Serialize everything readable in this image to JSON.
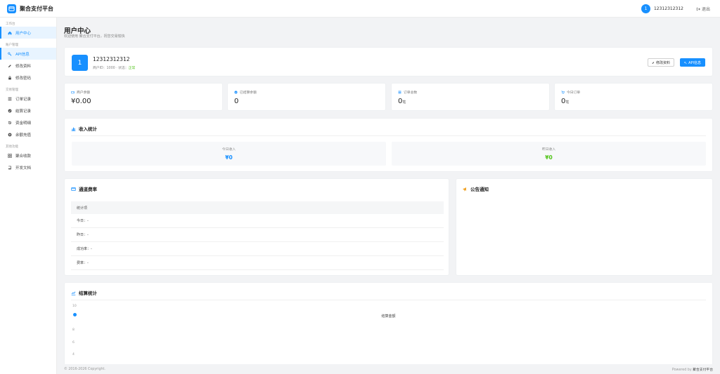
{
  "app": {
    "name": "聚合支付平台"
  },
  "header": {
    "user": "12312312312",
    "avatar_text": "1",
    "logout": "退出"
  },
  "sidebar": {
    "groups": [
      {
        "label": "工作台",
        "items": [
          {
            "label": "用户中心",
            "icon": "home-icon"
          }
        ]
      },
      {
        "label": "账户管理",
        "items": [
          {
            "label": "API信息",
            "icon": "key-icon"
          },
          {
            "label": "修改资料",
            "icon": "pencil-icon"
          },
          {
            "label": "修改密码",
            "icon": "lock-icon"
          }
        ]
      },
      {
        "label": "交易管理",
        "items": [
          {
            "label": "订单记录",
            "icon": "list-icon"
          },
          {
            "label": "结算记录",
            "icon": "check-circle-icon"
          },
          {
            "label": "资金明细",
            "icon": "history-icon"
          },
          {
            "label": "余额充值",
            "icon": "plus-circle-icon"
          }
        ]
      },
      {
        "label": "其他功能",
        "items": [
          {
            "label": "聚合收款",
            "icon": "grid-icon"
          },
          {
            "label": "开发文档",
            "icon": "book-icon"
          }
        ]
      }
    ]
  },
  "page": {
    "title": "用户中心",
    "subtitle": "欢迎使用 聚合支付平台，祝您交易愉快"
  },
  "profile": {
    "avatar_text": "1",
    "name": "12312312312",
    "meta": "商户ID：1000 · 状态：",
    "status": "正常",
    "edit_label": "修改资料",
    "api_label": "API信息"
  },
  "stats": [
    {
      "label": "商户余额",
      "value": "¥0.00",
      "unit": "",
      "icon": "wallet-icon",
      "color": "#1890ff"
    },
    {
      "label": "已结算余额",
      "value": "0",
      "unit": "",
      "icon": "check-circle-icon",
      "color": "#1890ff"
    },
    {
      "label": "订单总数",
      "value": "0",
      "unit": "笔",
      "icon": "list-icon",
      "color": "#1890ff"
    },
    {
      "label": "今日订单",
      "value": "0",
      "unit": "笔",
      "icon": "cart-icon",
      "color": "#1890ff"
    }
  ],
  "income": {
    "title": "收入统计",
    "today": {
      "label": "今日收入",
      "value": "¥0",
      "color": "#1890ff"
    },
    "yesterday": {
      "label": "昨日收入",
      "value": "¥0",
      "color": "#52c41a"
    }
  },
  "channel": {
    "title": "通道费率",
    "header": "统计项",
    "rows": [
      "今日：-",
      "昨日：-",
      "成功率：-",
      "费率：-"
    ]
  },
  "notice": {
    "title": "公告通知"
  },
  "settle": {
    "title": "结算统计",
    "legend": "结算金额",
    "yticks": [
      "10",
      "8",
      "6",
      "4",
      "2"
    ]
  },
  "footer": {
    "copyright": "© 2016-2026 Copyright.",
    "powered_prefix": "Powered by ",
    "powered_name": "聚合支付平台"
  }
}
